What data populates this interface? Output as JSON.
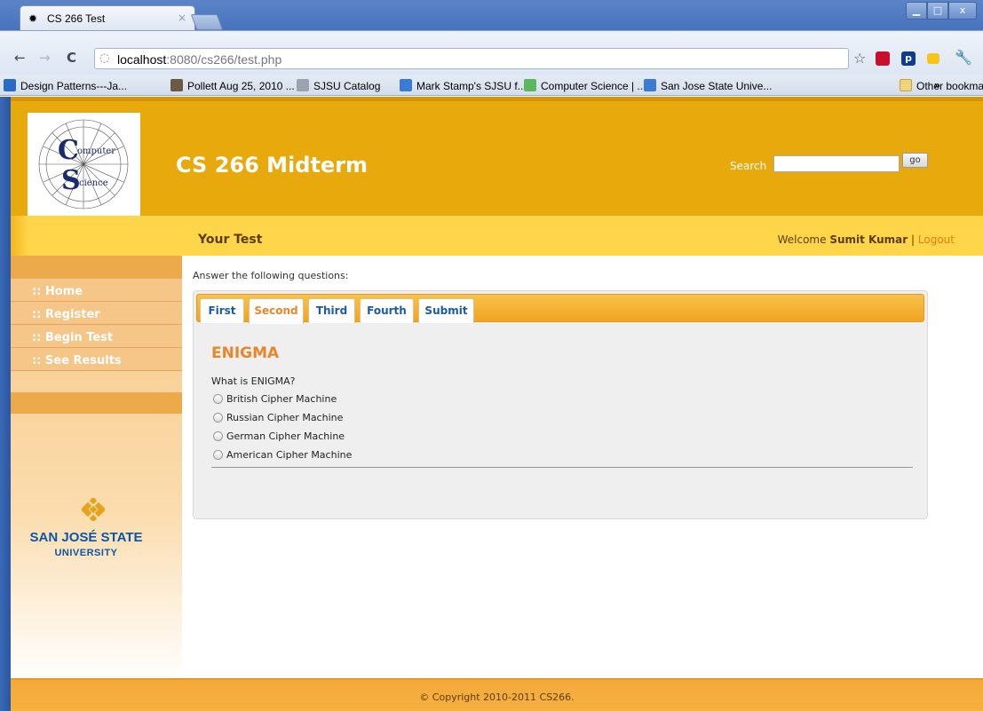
{
  "browser": {
    "tab_title": "CS 266 Test",
    "tab_close": "×",
    "url_host": "localhost",
    "url_rest": ":8080/cs266/test.php",
    "bookmarks": [
      {
        "label": "Design Patterns---Ja...",
        "color": "#2a6cc4"
      },
      {
        "label": "Pollett Aug 25, 2010 ...",
        "color": "#6b5a44"
      },
      {
        "label": "SJSU Catalog",
        "color": "#9aa3b0"
      },
      {
        "label": "Mark Stamp's SJSU f...",
        "color": "#3a7bd5"
      },
      {
        "label": "Computer Science | ...",
        "color": "#5cb85c"
      },
      {
        "label": "San Jose State Unive...",
        "color": "#3a7bd5"
      }
    ],
    "bookmarks_overflow": "»",
    "other_bookmarks": "Other bookmarks"
  },
  "header": {
    "site_title": "CS 266 Midterm",
    "search_label": "Search",
    "search_value": "",
    "go_label": "go",
    "logo_alt": "Computer Science"
  },
  "subbar": {
    "title": "Your Test",
    "welcome_prefix": "Welcome",
    "user_name": "Sumit Kumar",
    "separator": "|",
    "logout_label": "Logout"
  },
  "sidebar": {
    "items": [
      {
        "label": ":: Home"
      },
      {
        "label": ":: Register"
      },
      {
        "label": ":: Begin Test"
      },
      {
        "label": ":: See Results"
      }
    ],
    "university_name": "SAN JOSÉ STATE",
    "university_sub": "UNIVERSITY"
  },
  "main": {
    "intro": "Answer the following questions:",
    "tabs": [
      {
        "label": "First"
      },
      {
        "label": "Second"
      },
      {
        "label": "Third"
      },
      {
        "label": "Fourth"
      },
      {
        "label": "Submit"
      }
    ],
    "active_tab": "Second",
    "question_title": "ENIGMA",
    "question_text": "What is ENIGMA?",
    "options": [
      {
        "label": "British Cipher Machine"
      },
      {
        "label": "Russian Cipher Machine"
      },
      {
        "label": "German Cipher Machine"
      },
      {
        "label": "American Cipher Machine"
      }
    ]
  },
  "footer": {
    "text": "© Copyright 2010-2011 CS266."
  },
  "colors": {
    "header_bg": "#e7a90c",
    "subbar_bg": "#ffd54a",
    "accent_orange": "#e8862a",
    "link_blue": "#1b5aa6",
    "university_blue": "#0b57a4"
  }
}
